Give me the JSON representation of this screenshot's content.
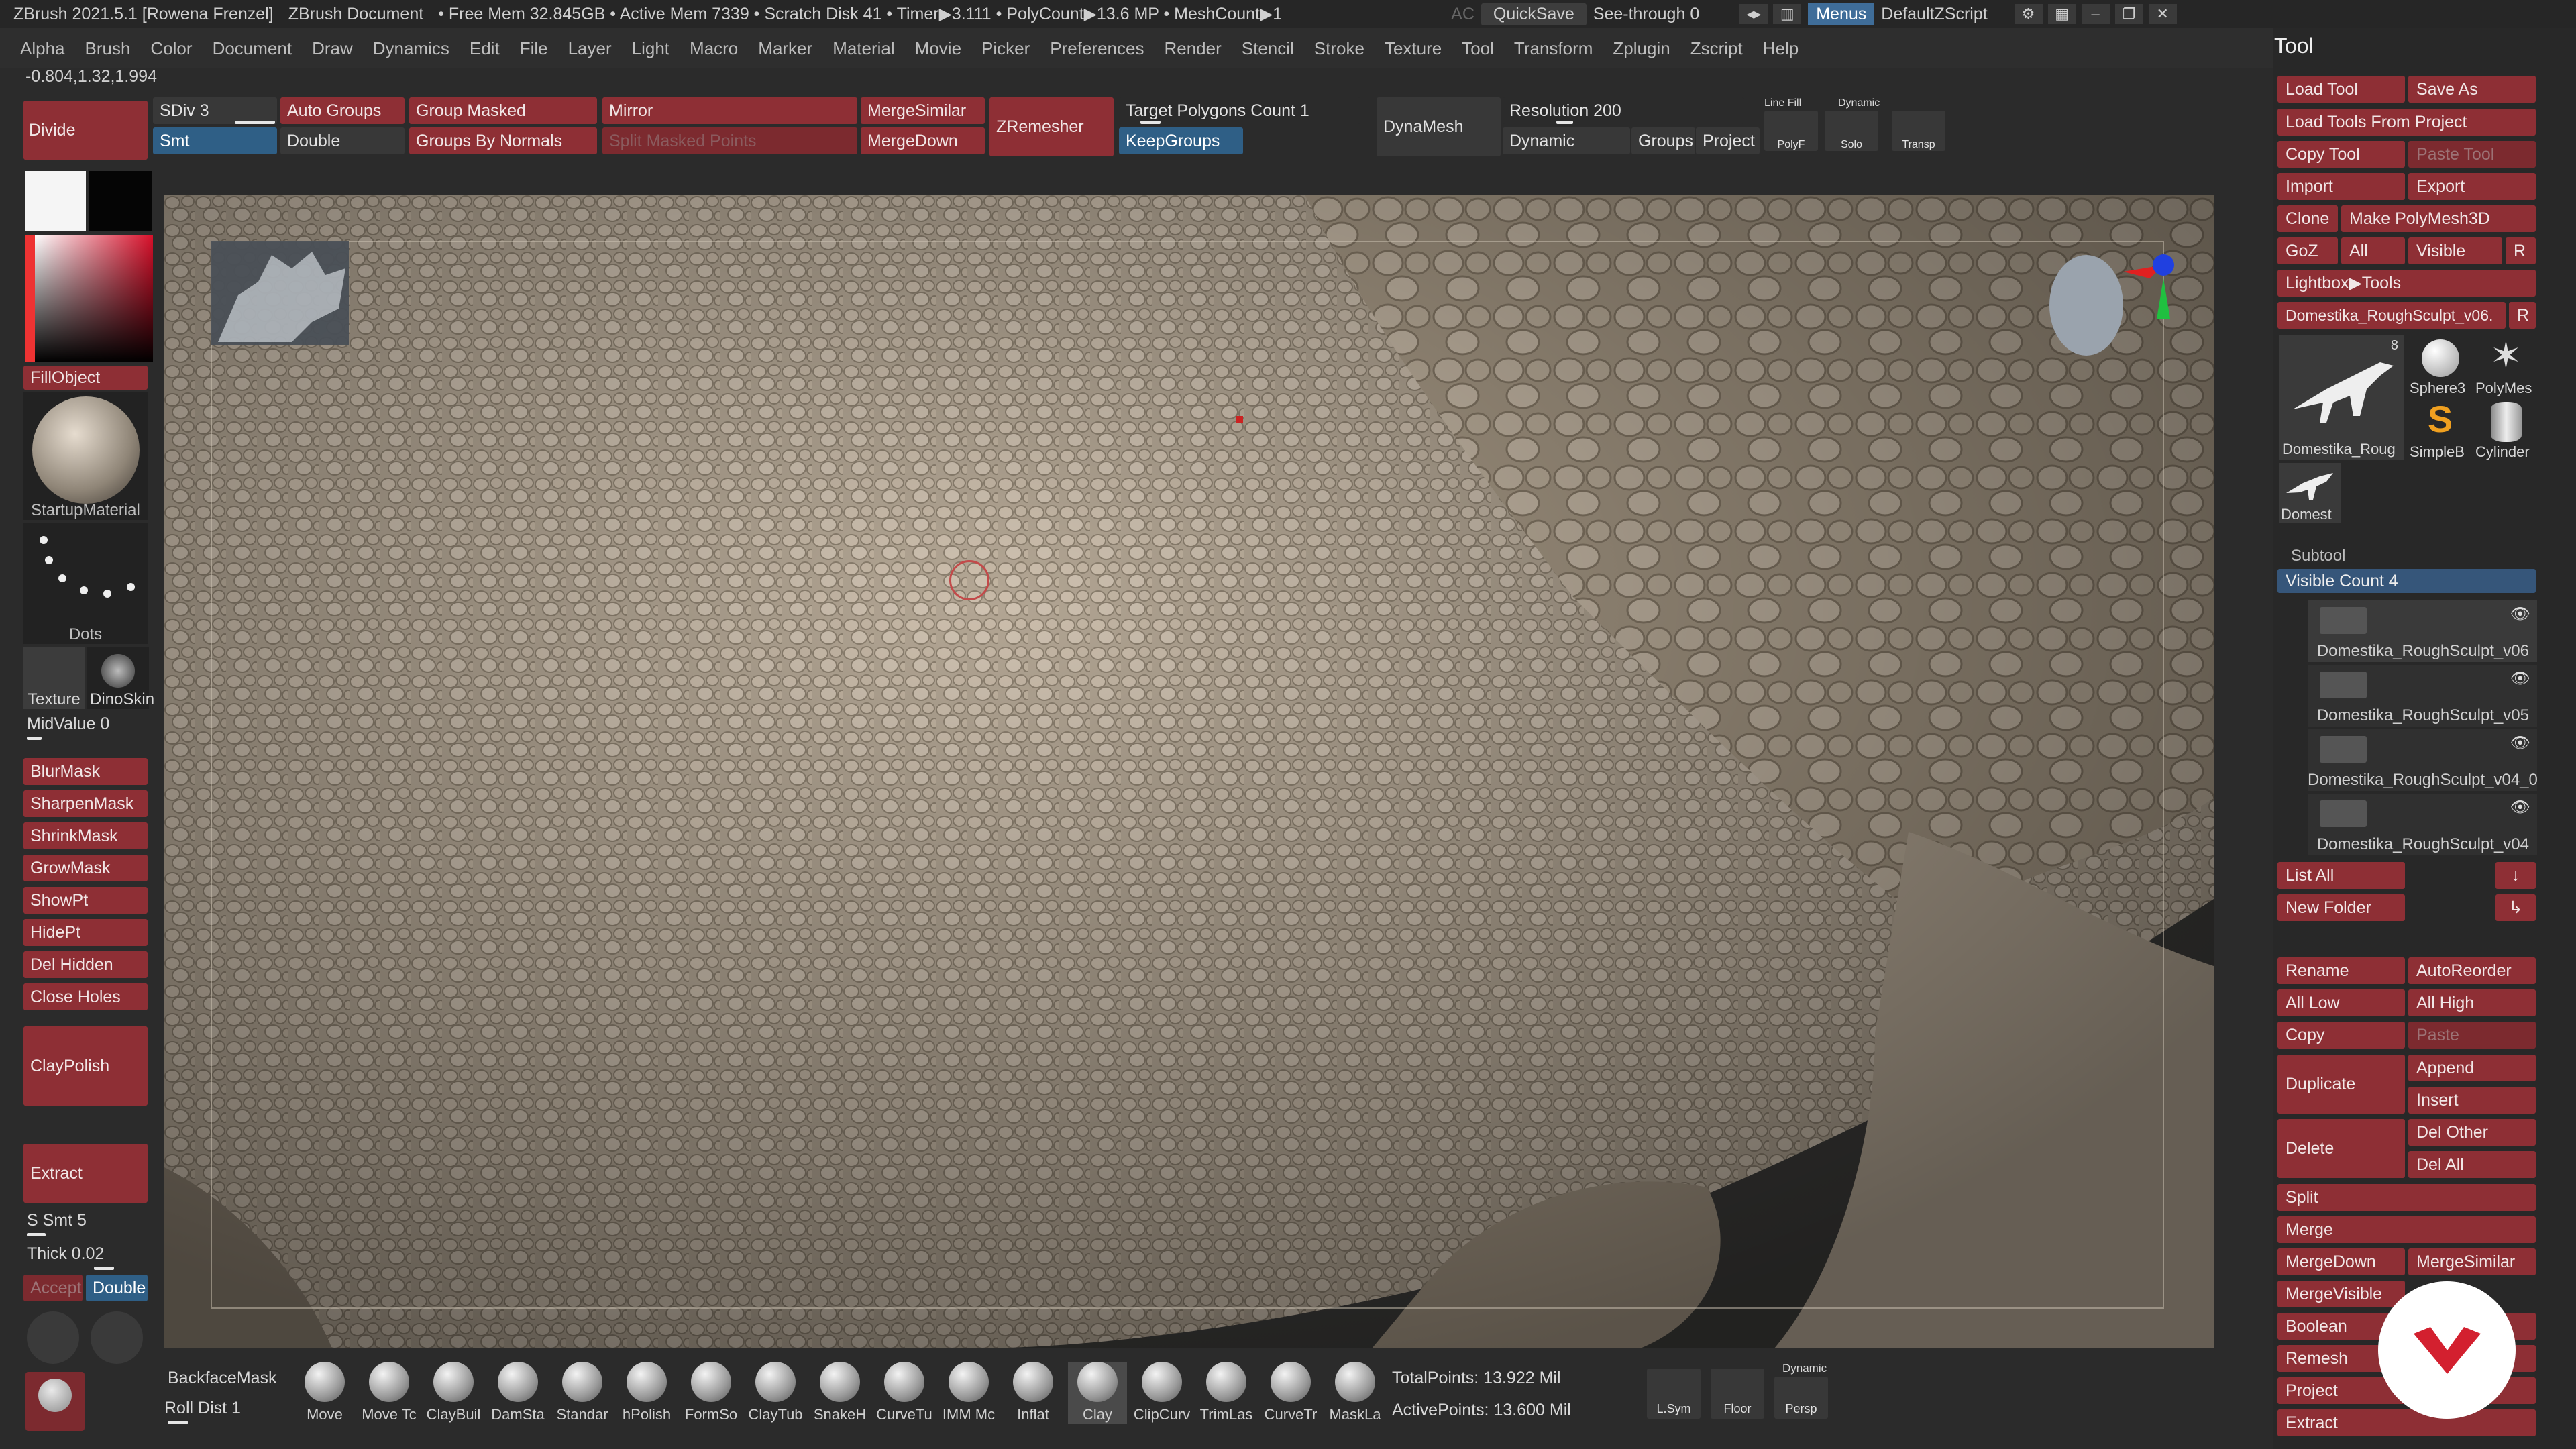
{
  "titlebar": {
    "app": "ZBrush 2021.5.1 [Rowena Frenzel]",
    "doc": "ZBrush Document",
    "mem": "• Free Mem 32.845GB • Active Mem 7339 • Scratch Disk 41 • Timer▶3.111 • PolyCount▶13.6 MP • MeshCount▶1",
    "ac": "AC",
    "quicksave": "QuickSave",
    "seethrough": "See-through",
    "seethrough_val": "0",
    "menus": "Menus",
    "script": "DefaultZScript"
  },
  "menubar": [
    "Alpha",
    "Brush",
    "Color",
    "Document",
    "Draw",
    "Dynamics",
    "Edit",
    "File",
    "Layer",
    "Light",
    "Macro",
    "Marker",
    "Material",
    "Movie",
    "Picker",
    "Preferences",
    "Render",
    "Stencil",
    "Stroke",
    "Texture",
    "Tool",
    "Transform",
    "Zplugin",
    "Zscript",
    "Help"
  ],
  "coords": "-0.804,1.32,1.994",
  "topshelf": {
    "divide": "Divide",
    "sdiv": "SDiv 3",
    "smt": "Smt",
    "auto_groups": "Auto Groups",
    "double": "Double",
    "group_masked": "Group Masked",
    "groups_by_normals": "Groups By Normals",
    "mirror": "Mirror",
    "split_masked": "Split Masked Points",
    "merge_similar": "MergeSimilar",
    "merge_down": "MergeDown",
    "zremesher": "ZRemesher",
    "target_poly": "Target Polygons Count 1",
    "keep_groups": "KeepGroups",
    "dynamesh": "DynaMesh",
    "resolution": "Resolution 200",
    "dynamic": "Dynamic",
    "groups": "Groups",
    "project": "Project",
    "linefill": "Line Fill",
    "polyf": "PolyF",
    "dynamic_small": "Dynamic",
    "solo": "Solo",
    "transp": "Transp"
  },
  "leftpanel": {
    "fillobject": "FillObject",
    "material": "StartupMaterial",
    "stroke": "Dots",
    "texture": "Texture",
    "alpha": "DinoSkin",
    "midvalue": "MidValue 0",
    "mask_buttons": [
      "BlurMask",
      "SharpenMask",
      "ShrinkMask",
      "GrowMask",
      "ShowPt",
      "HidePt",
      "Del Hidden",
      "Close Holes"
    ],
    "claypolish": "ClayPolish",
    "extract": "Extract",
    "ssmt": "S Smt 5",
    "thick": "Thick 0.02",
    "accept": "Accept",
    "double": "Double"
  },
  "bottom": {
    "backface": "BackfaceMask",
    "rolldist": "Roll Dist 1",
    "brushes": [
      "Move",
      "Move Tc",
      "ClayBuil",
      "DamSta",
      "Standar",
      "hPolish",
      "FormSo",
      "ClayTub",
      "SnakeH",
      "CurveTu",
      "IMM Mc",
      "Inflat",
      "Clay",
      "ClipCurv",
      "TrimLas",
      "CurveTr",
      "MaskLa"
    ],
    "totalpoints": "TotalPoints: 13.922 Mil",
    "activepoints": "ActivePoints: 13.600 Mil",
    "lsym": "L.Sym",
    "floor": "Floor",
    "persp": "Persp",
    "dynamic": "Dynamic"
  },
  "tool": {
    "title": "Tool",
    "load_tool": "Load Tool",
    "save_as": "Save As",
    "load_from_project": "Load Tools From Project",
    "copy_tool": "Copy Tool",
    "paste_tool": "Paste Tool",
    "import": "Import",
    "export": "Export",
    "clone": "Clone",
    "make_polymesh": "Make PolyMesh3D",
    "goz": "GoZ",
    "all": "All",
    "visible": "Visible",
    "r": "R",
    "lightbox": "Lightbox▶Tools",
    "current_tool": "Domestika_RoughSculpt_v06.",
    "thumb_count": "8",
    "thumb_name": "Domestika_Roug",
    "sphere": "Sphere3",
    "polymesh": "PolyMes",
    "simpleb": "SimpleB",
    "cylinder": "Cylinder",
    "small_name": "Domest"
  },
  "subtool": {
    "header": "Subtool",
    "visible_count": "Visible Count 4",
    "items": [
      "Domestika_RoughSculpt_v06",
      "Domestika_RoughSculpt_v05",
      "Domestika_RoughSculpt_v04_0",
      "Domestika_RoughSculpt_v04"
    ],
    "list_all": "List All",
    "new_folder": "New Folder",
    "rename": "Rename",
    "autoreorder": "AutoReorder",
    "all_low": "All Low",
    "all_high": "All High",
    "copy": "Copy",
    "paste": "Paste",
    "duplicate": "Duplicate",
    "append": "Append",
    "insert": "Insert",
    "delete": "Delete",
    "del_other": "Del Other",
    "del_all": "Del All",
    "split": "Split",
    "merge": "Merge",
    "merge_down": "MergeDown",
    "merge_similar": "MergeSimilar",
    "merge_visible": "MergeVisible",
    "boolean": "Boolean",
    "remesh": "Remesh",
    "project": "Project",
    "extract": "Extract"
  },
  "colors": {
    "accent_red": "#8e2f35",
    "accent_blue": "#2f5f86",
    "logo_red": "#d3202f"
  }
}
